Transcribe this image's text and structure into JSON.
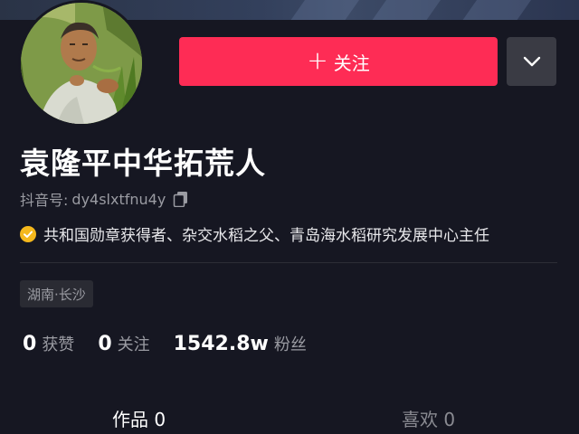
{
  "profile": {
    "name": "袁隆平中华拓荒人",
    "account_label": "抖音号:",
    "account_id": "dy4slxtfnu4y",
    "verification_text": "共和国勋章获得者、杂交水稻之父、青岛海水稻研究发展中心主任",
    "location": "湖南·长沙"
  },
  "actions": {
    "follow_label": "关注",
    "follow_icon": "plus-icon",
    "more_icon": "chevron-down-icon"
  },
  "stats": [
    {
      "value": "0",
      "label": "获赞"
    },
    {
      "value": "0",
      "label": "关注"
    },
    {
      "value": "1542.8w",
      "label": "粉丝"
    }
  ],
  "tabs": [
    {
      "label": "作品 0",
      "active": true
    },
    {
      "label": "喜欢 0",
      "active": false
    }
  ],
  "colors": {
    "background": "#161722",
    "follow_button": "#fe2c55",
    "verified_badge": "#f5b81c",
    "secondary_text": "#9a9ba2"
  }
}
